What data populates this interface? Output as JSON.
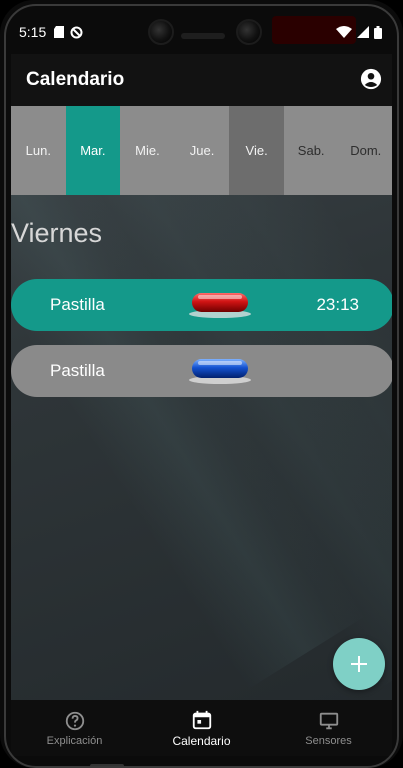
{
  "status_bar": {
    "time": "5:15"
  },
  "app_bar": {
    "title": "Calendario"
  },
  "days": [
    {
      "label": "Lun.",
      "state": "normal"
    },
    {
      "label": "Mar.",
      "state": "active"
    },
    {
      "label": "Mie.",
      "state": "normal"
    },
    {
      "label": "Jue.",
      "state": "normal"
    },
    {
      "label": "Vie.",
      "state": "dim"
    },
    {
      "label": "Sab.",
      "state": "weekend"
    },
    {
      "label": "Dom.",
      "state": "weekend"
    }
  ],
  "day_heading": "Viernes",
  "reminders": [
    {
      "name": "Pastilla",
      "time": "23:13",
      "pill_color": "red"
    },
    {
      "name": "Pastilla",
      "time": "",
      "pill_color": "blue"
    }
  ],
  "fab_icon": "plus-icon",
  "bottom_nav": [
    {
      "label": "Explicación",
      "icon": "help-circle-icon",
      "active": false
    },
    {
      "label": "Calendario",
      "icon": "calendar-icon",
      "active": true
    },
    {
      "label": "Sensores",
      "icon": "monitor-icon",
      "active": false
    }
  ],
  "colors": {
    "accent": "#14998a",
    "fab": "#7fd0c6",
    "inactive_pill": "#8a8a8a"
  }
}
